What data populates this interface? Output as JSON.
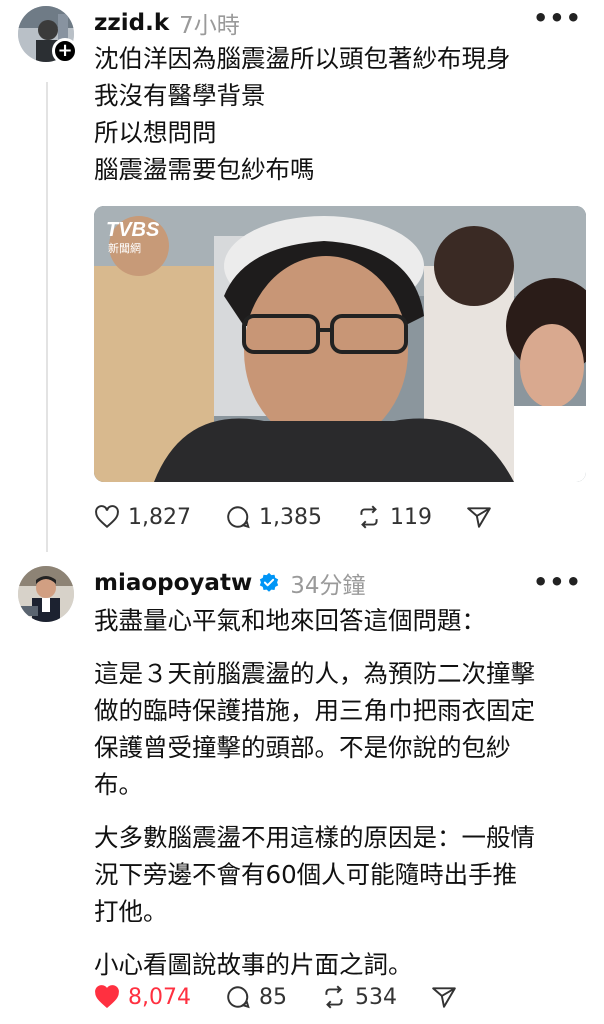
{
  "post1": {
    "username": "zzid.k",
    "time": "7小時",
    "lines": [
      "沈伯洋因為腦震盪所以頭包著紗布現身",
      "我沒有醫學背景",
      "所以想問問",
      "腦震盪需要包紗布嗎"
    ],
    "image_watermark": "TVBS 新聞網",
    "likes": "1,827",
    "comments": "1,385",
    "reposts": "119"
  },
  "post2": {
    "username": "miaopoyatw",
    "time": "34分鐘",
    "paragraphs": [
      [
        "我盡量心平氣和地來回答這個問題："
      ],
      [
        "這是３天前腦震盪的人，為預防二次撞擊",
        "做的臨時保護措施，用三角巾把雨衣固定",
        "保護曾受撞擊的頭部。不是你說的包紗",
        "布。"
      ],
      [
        "大多數腦震盪不用這樣的原因是：一般情",
        "況下旁邊不會有60個人可能隨時出手推",
        "打他。"
      ],
      [
        "小心看圖說故事的片面之詞。"
      ]
    ],
    "likes": "8,074",
    "comments": "85",
    "reposts": "534"
  },
  "colors": {
    "like_active": "#ff3040",
    "verified": "#0095f6"
  },
  "icons": [
    "heart-icon",
    "comment-icon",
    "repost-icon",
    "share-icon",
    "more-icon",
    "verified-badge-icon",
    "follow-plus-icon"
  ]
}
